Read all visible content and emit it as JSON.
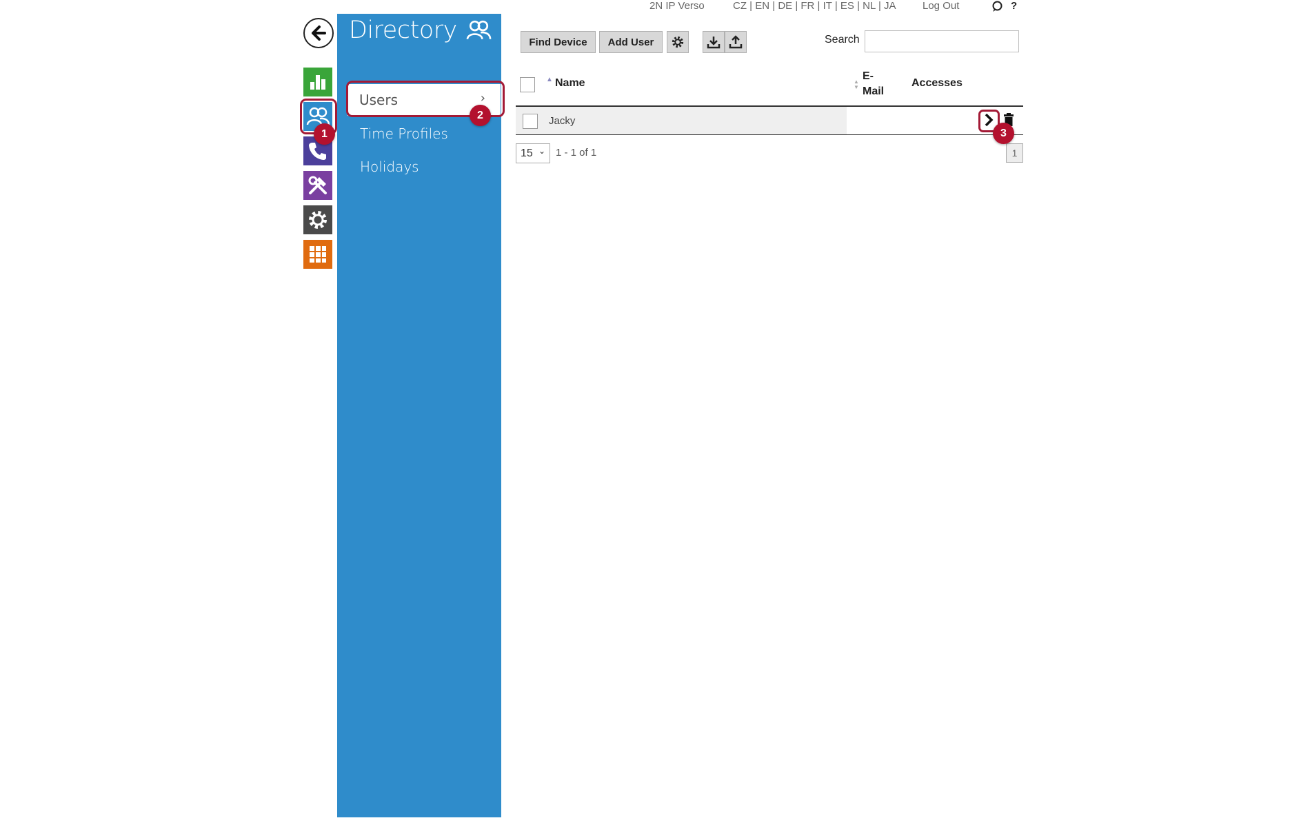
{
  "header": {
    "device_name": "2N IP Verso",
    "languages": [
      "CZ",
      "EN",
      "DE",
      "FR",
      "IT",
      "ES",
      "NL",
      "JA"
    ],
    "logout": "Log Out",
    "help": "?"
  },
  "sidebar": {
    "tiles": [
      {
        "icon": "chart-icon",
        "color": "#3aa53a"
      },
      {
        "icon": "users-icon",
        "color": "#2f8ccb"
      },
      {
        "icon": "phone-icon",
        "color": "#4b3f9b"
      },
      {
        "icon": "tools-icon",
        "color": "#7a3fa0"
      },
      {
        "icon": "gear-icon",
        "color": "#4a4a4a"
      },
      {
        "icon": "grid-icon",
        "color": "#e06b0f"
      }
    ]
  },
  "panel": {
    "title": "Directory",
    "items": [
      "Users",
      "Time Profiles",
      "Holidays"
    ],
    "active_index": 0
  },
  "toolbar": {
    "find_device": "Find Device",
    "add_user": "Add User",
    "search_label": "Search",
    "search_value": ""
  },
  "table": {
    "columns": {
      "name": "Name",
      "email_line1": "E-",
      "email_line2": "Mail",
      "accesses": "Accesses"
    },
    "rows": [
      {
        "name": "Jacky",
        "email": "",
        "accesses": ""
      }
    ]
  },
  "pager": {
    "page_size": "15",
    "range": "1 - 1 of 1",
    "current_page": "1"
  },
  "annotations": [
    "1",
    "2",
    "3"
  ]
}
